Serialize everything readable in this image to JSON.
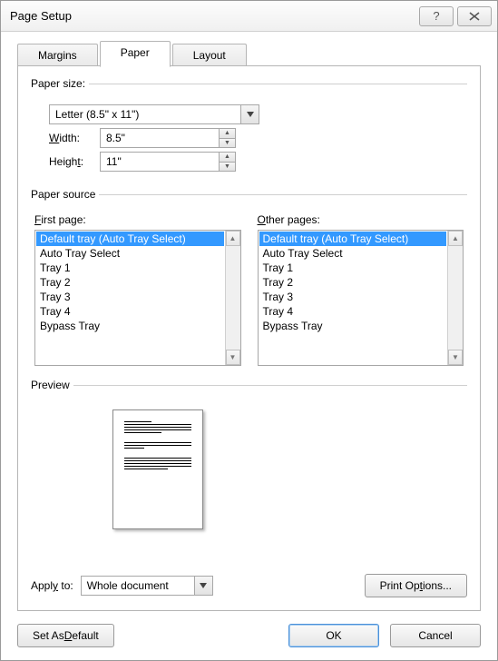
{
  "window": {
    "title": "Page Setup"
  },
  "tabs": {
    "margins": "Margins",
    "paper": "Paper",
    "layout": "Layout"
  },
  "paper_size": {
    "legend": "Paper size:",
    "selected": "Letter (8.5\" x 11\")",
    "width_label_pre": "",
    "width_u": "W",
    "width_label_post": "idth:",
    "height_label_pre": "Heigh",
    "height_u": "t",
    "height_label_post": ":",
    "width": "8.5\"",
    "height": "11\""
  },
  "paper_source": {
    "legend": "Paper source",
    "first_pre": "",
    "first_u": "F",
    "first_post": "irst page:",
    "other_pre": "",
    "other_u": "O",
    "other_post": "ther pages:",
    "first_items": [
      "Default tray (Auto Tray Select)",
      "Auto Tray Select",
      "Tray 1",
      "Tray 2",
      "Tray 3",
      "Tray 4",
      "Bypass Tray"
    ],
    "other_items": [
      "Default tray (Auto Tray Select)",
      "Auto Tray Select",
      "Tray 1",
      "Tray 2",
      "Tray 3",
      "Tray 4",
      "Bypass Tray"
    ]
  },
  "preview": {
    "legend": "Preview"
  },
  "apply": {
    "label_pre": "Appl",
    "label_u": "y",
    "label_post": " to:",
    "value": "Whole document"
  },
  "buttons": {
    "print_options_pre": "Print Op",
    "print_options_u": "t",
    "print_options_post": "ions...",
    "set_default_pre": "Set As ",
    "set_default_u": "D",
    "set_default_post": "efault",
    "ok": "OK",
    "cancel": "Cancel"
  }
}
